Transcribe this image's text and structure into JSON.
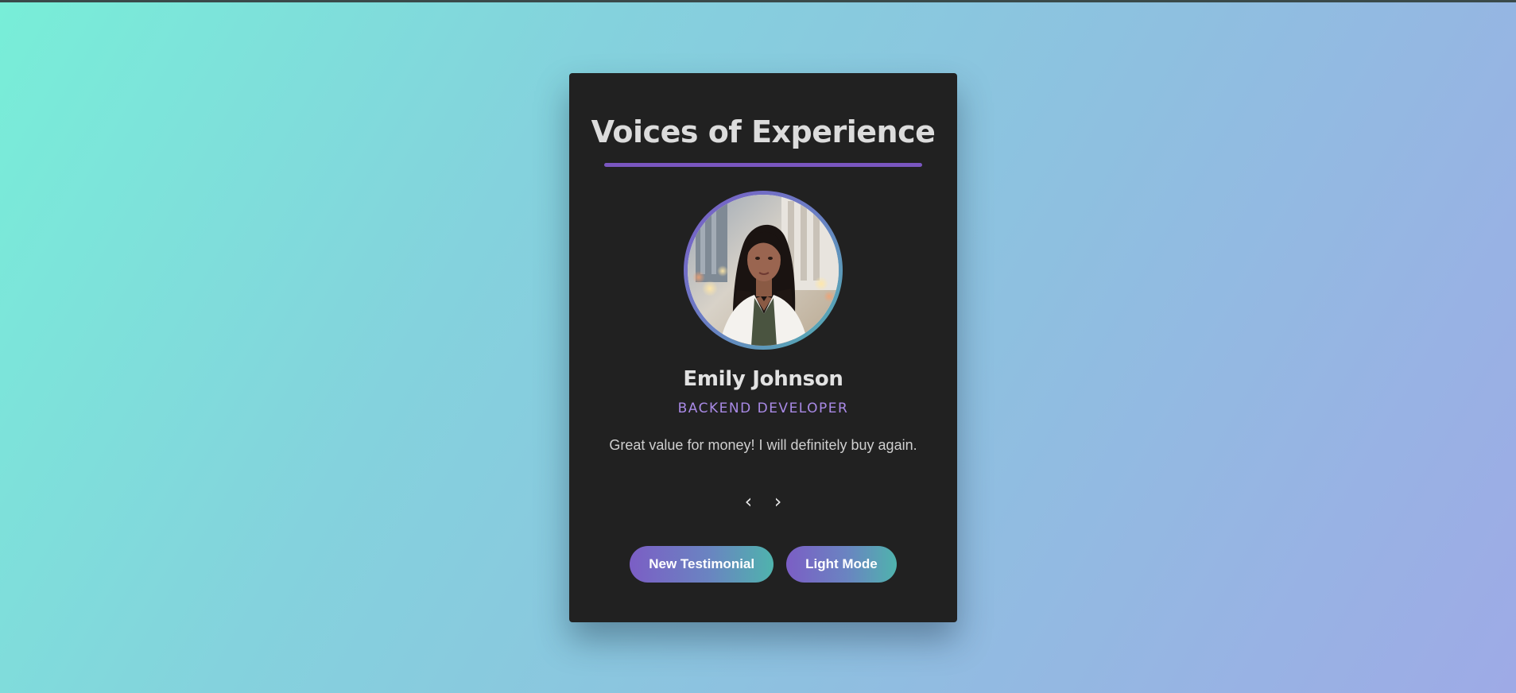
{
  "page": {
    "background_start": "#78eed8",
    "background_end": "#9eaae6"
  },
  "card": {
    "background": "#212121",
    "title": "Voices of Experience",
    "accent": "#7a56c0"
  },
  "testimonial": {
    "avatar_alt": "Emily Johnson",
    "name": "Emily Johnson",
    "role": "Backend Developer",
    "quote": "Great value for money! I will definitely buy again."
  },
  "navigation": {
    "prev_label": "‹",
    "next_label": "›",
    "prev_icon": "chevron-left-icon",
    "next_icon": "chevron-right-icon"
  },
  "actions": {
    "new_testimonial_label": "New Testimonial",
    "light_mode_label": "Light Mode"
  }
}
